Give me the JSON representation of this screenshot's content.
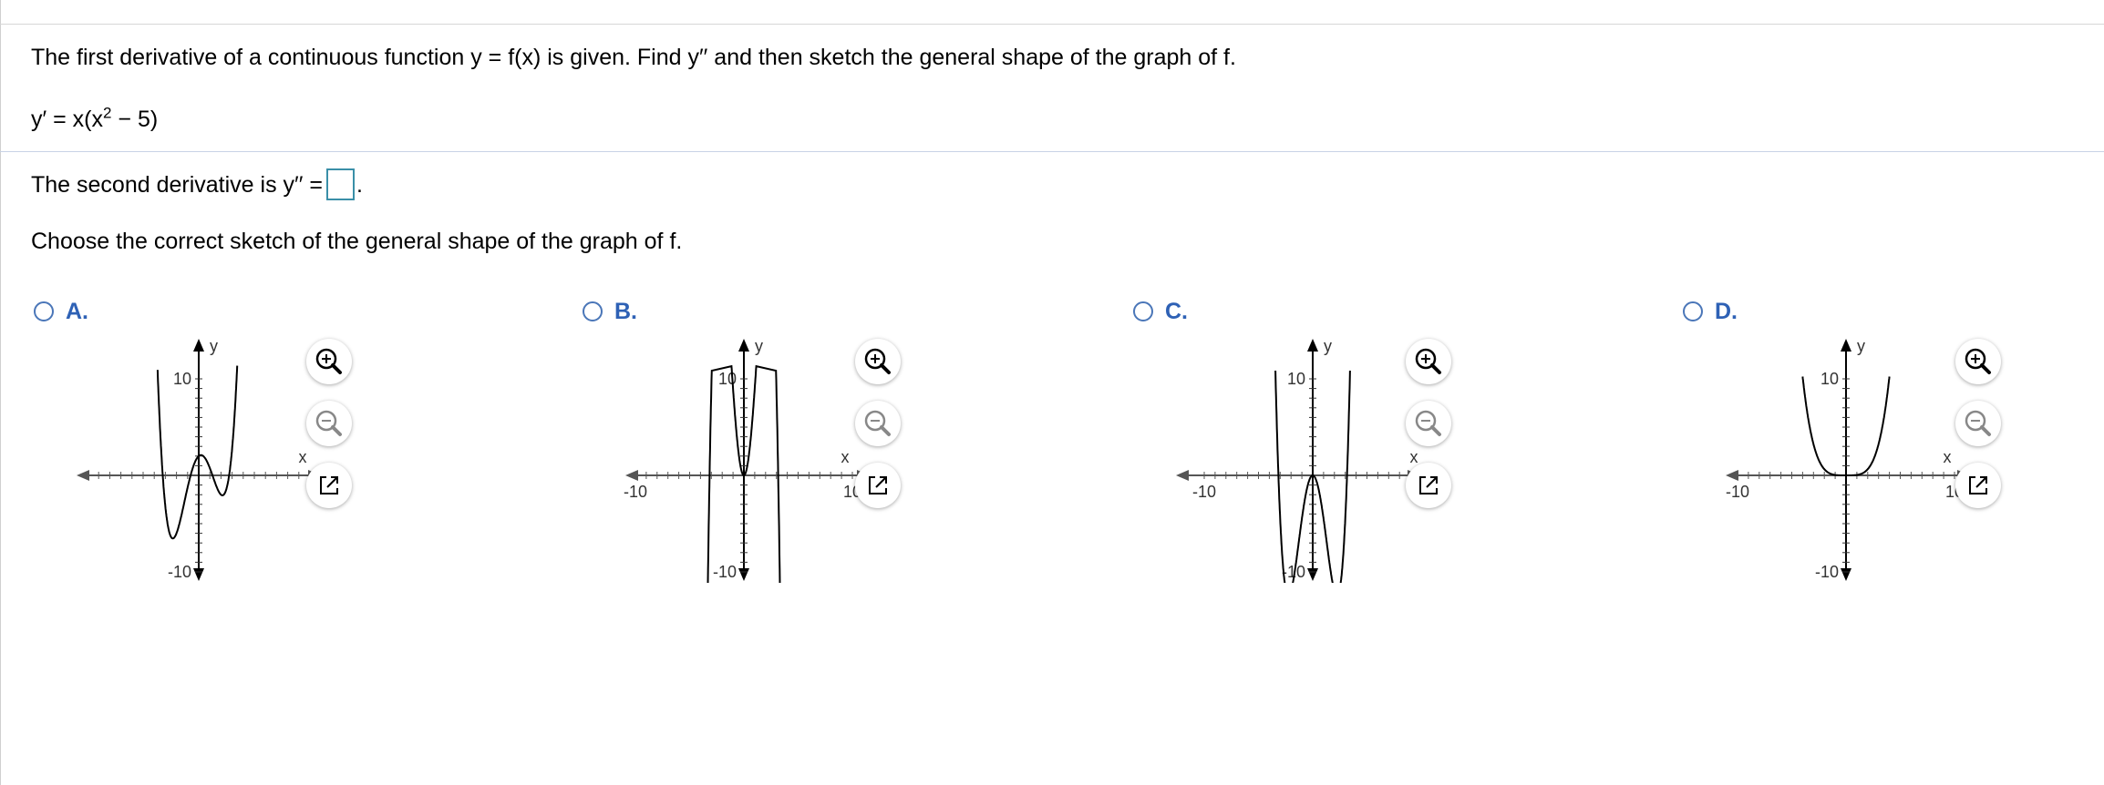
{
  "question": {
    "intro": "The first derivative of a continuous function y = f(x) is given. Find y′′ and then sketch the general shape of the graph of f.",
    "given_left": "y′ = x(x",
    "given_exp": "2",
    "given_right": " − 5)",
    "second_derivative_prefix": "The second derivative is y′′ =",
    "second_derivative_suffix": ".",
    "choose_prompt": "Choose the correct sketch of the general shape of the graph of f."
  },
  "choices": [
    {
      "letter": "A.",
      "y_top": "10",
      "y_bottom": "-10",
      "x_left": "",
      "x_right": "",
      "x_axis": "x",
      "y_axis": "y"
    },
    {
      "letter": "B.",
      "y_top": "10",
      "y_bottom": "-10",
      "x_left": "-10",
      "x_right": "10",
      "x_axis": "x",
      "y_axis": "y"
    },
    {
      "letter": "C.",
      "y_top": "10",
      "y_bottom": "-10",
      "x_left": "-10",
      "x_right": "10",
      "x_axis": "x",
      "y_axis": "y"
    },
    {
      "letter": "D.",
      "y_top": "10",
      "y_bottom": "-10",
      "x_left": "-10",
      "x_right": "10",
      "x_axis": "x",
      "y_axis": "y"
    }
  ],
  "colors": {
    "accent": "#2e61b5",
    "box_border": "#3a8fa8"
  },
  "icons": {
    "zoom_in": "zoom-in-icon",
    "zoom_out": "zoom-out-icon",
    "popout": "popout-icon",
    "radio": "radio-icon"
  }
}
